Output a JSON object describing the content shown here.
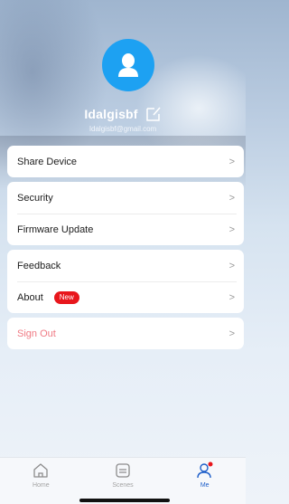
{
  "profile": {
    "username": "Idalgisbf",
    "email": "Idalgisbf@gmail.com"
  },
  "groups": [
    {
      "items": [
        {
          "label": "Share Device",
          "chevron": ">"
        }
      ]
    },
    {
      "items": [
        {
          "label": "Security",
          "chevron": ">"
        },
        {
          "label": "Firmware Update",
          "chevron": ">"
        }
      ]
    },
    {
      "items": [
        {
          "label": "Feedback",
          "chevron": ">"
        },
        {
          "label": "About",
          "badge": "New",
          "chevron": ">"
        }
      ]
    },
    {
      "items": [
        {
          "label": "Sign Out",
          "chevron": ">"
        }
      ]
    }
  ],
  "tabbar": {
    "tabs": [
      {
        "label": "Home",
        "icon": "home-icon",
        "active": false
      },
      {
        "label": "Scenes",
        "icon": "scenes-icon",
        "active": false
      },
      {
        "label": "Me",
        "icon": "person-icon",
        "active": true,
        "dot_color": "#e8161c"
      }
    ],
    "active_color": "#1d5ec9"
  },
  "colors": {
    "avatar": "#1da1f2",
    "badge": "#e8161c",
    "sign_out_text": "#f07a84"
  }
}
